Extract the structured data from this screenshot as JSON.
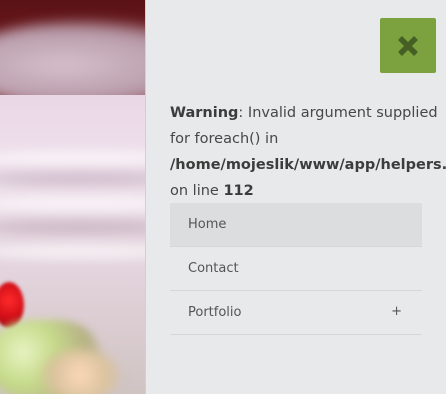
{
  "close_icon": "close-icon",
  "colors": {
    "close_button_bg": "#7ba23f",
    "close_icon": "#465f24",
    "panel_bg": "#e8e9ea",
    "active_item_bg": "#dcdddf"
  },
  "warning": {
    "label": "Warning",
    "line1_rest": ": Invalid argument supplied",
    "line2": "for foreach() in",
    "path": "/home/mojeslik/www/app/helpers.inc.php",
    "line4_prefix": "on line ",
    "line_number": "112"
  },
  "menu": {
    "items": [
      {
        "label": "Home",
        "active": true
      },
      {
        "label": "Contact",
        "active": false
      },
      {
        "label": "Portfolio",
        "active": false,
        "expand_symbol": "+"
      }
    ]
  }
}
